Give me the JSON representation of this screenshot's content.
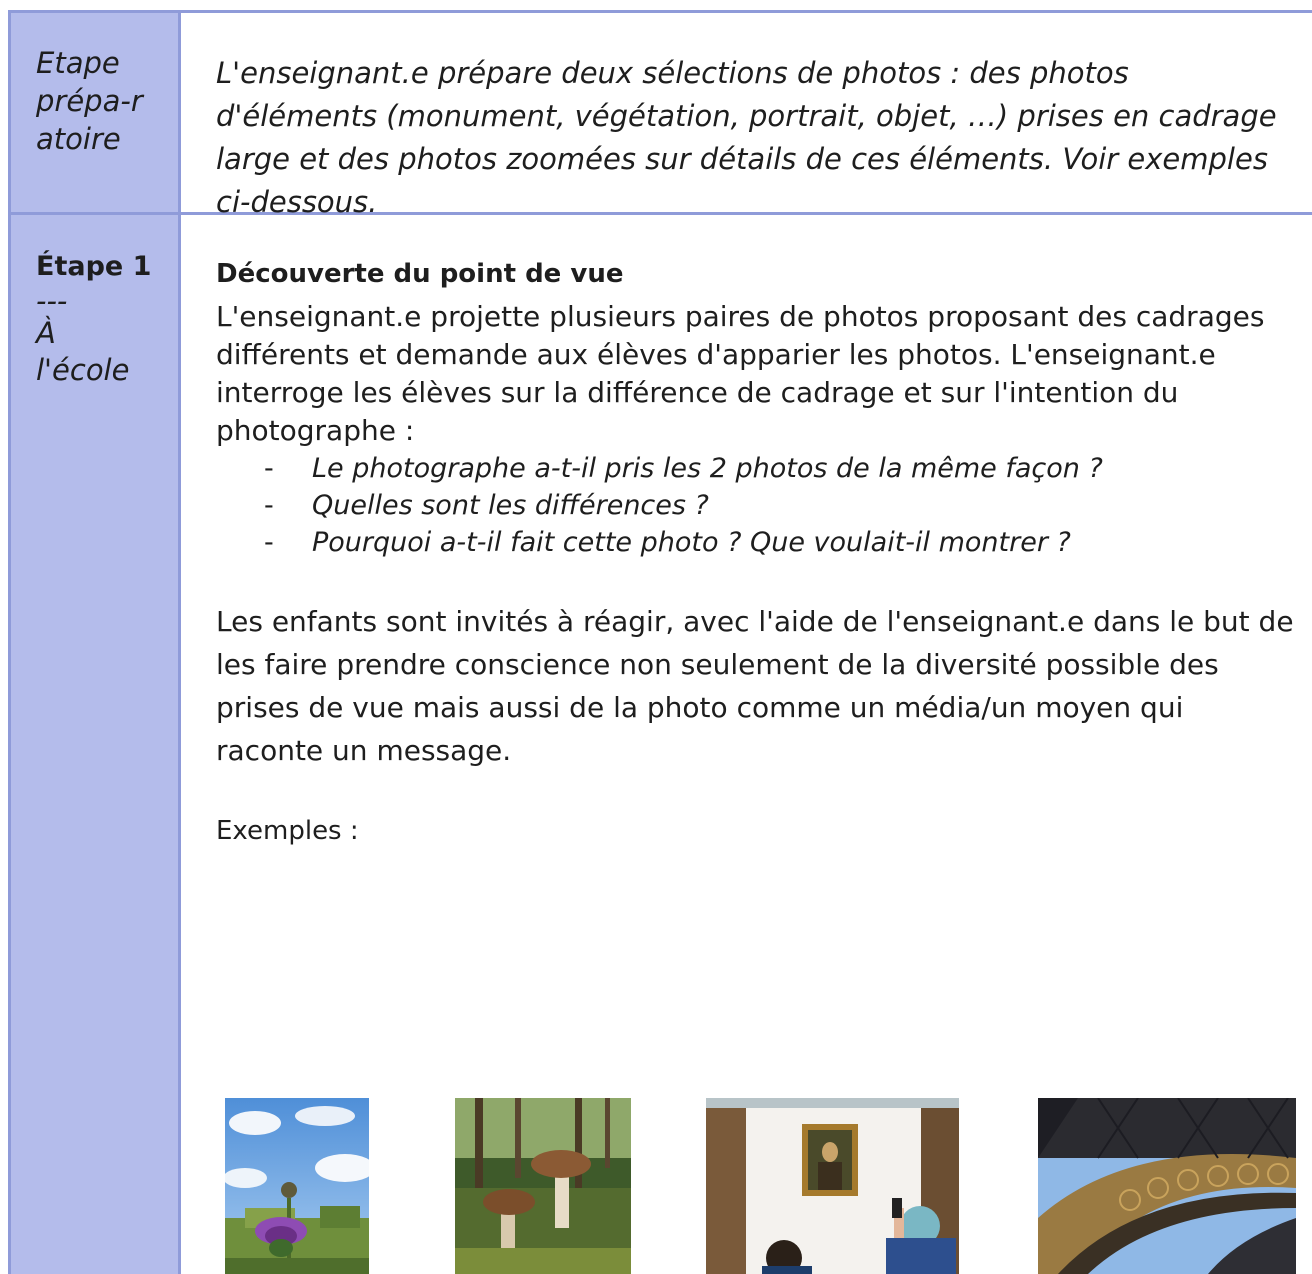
{
  "rows": [
    {
      "label": [
        "Etape",
        "prépa-r",
        "atoire"
      ],
      "text": "L'enseignant.e prépare deux sélections de photos : des photos d'éléments (monument, végétation, portrait, objet, …) prises en cadrage large et des photos zoomées sur détails de ces éléments. Voir exemples ci-dessous."
    }
  ],
  "step1": {
    "label_title": "Étape 1",
    "label_sep": "---",
    "label_place_1": "À",
    "label_place_2": "l'école",
    "title": "Découverte du point de vue",
    "para1": "L'enseignant.e projette plusieurs paires de photos proposant des cadrages différents et demande aux élèves d'apparier les photos. L'enseignant.e interroge les élèves sur la différence de cadrage et sur l'intention du photographe :",
    "bullets": [
      "Le photographe a-t-il pris les 2 photos de la même façon ?",
      "Quelles sont les différences ?",
      "Pourquoi a-t-il fait cette photo ? Que voulait-il montrer ?"
    ],
    "bullet_marker": "-",
    "para2": "Les enfants sont invités à réagir, avec l'aide de l'enseignant.e dans le but de les faire prendre conscience non seulement de la diversité possible des prises de vue mais aussi de la photo comme un média/un moyen qui raconte un message.",
    "examples_label": "Exemples :"
  },
  "photos": [
    {
      "name": "photo-thistle",
      "subject": "thistle flower"
    },
    {
      "name": "photo-mushrooms",
      "subject": "mushrooms in forest"
    },
    {
      "name": "photo-mona-lisa",
      "subject": "Mona Lisa museum visitors"
    },
    {
      "name": "photo-eiffel-detail",
      "subject": "Eiffel tower ironwork detail"
    }
  ],
  "colors": {
    "label_column": "#b4bceb",
    "grid_line": "#8f9bd9"
  }
}
